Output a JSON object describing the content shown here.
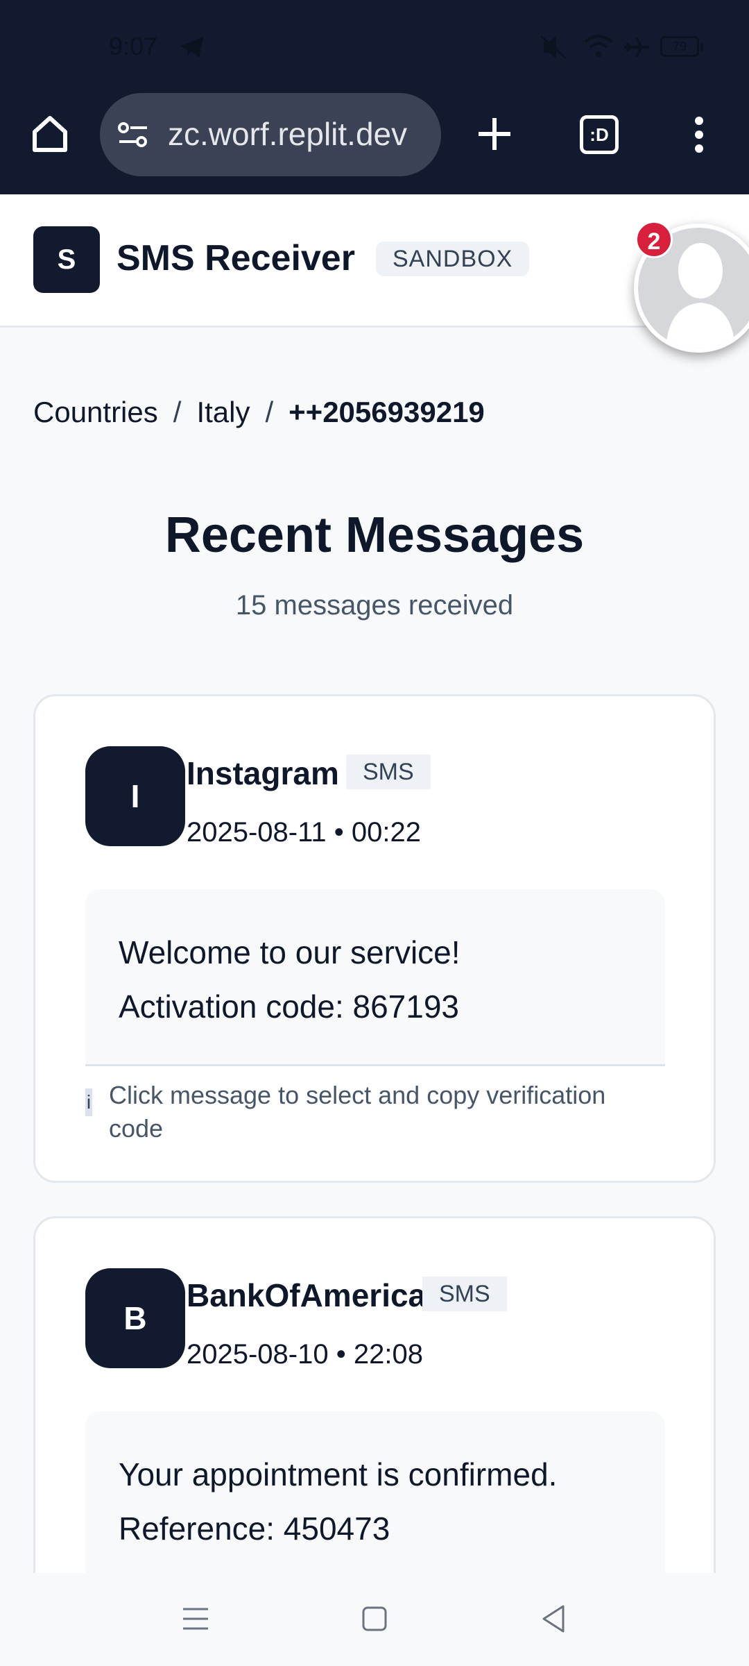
{
  "status_bar": {
    "time": "9:07",
    "battery": "79",
    "icons": [
      "telegram-icon",
      "mute-icon",
      "wifi-icon",
      "airplane-icon",
      "battery-icon"
    ]
  },
  "browser": {
    "url": "zc.worf.replit.dev",
    "tab_count": ":D",
    "icons": [
      "home-icon",
      "site-settings-icon",
      "new-tab-icon",
      "tab-switcher-icon",
      "more-menu-icon"
    ]
  },
  "header": {
    "logo_letter": "S",
    "title": "SMS Receiver",
    "badge": "SANDBOX",
    "notification_count": "2"
  },
  "breadcrumb": {
    "items": [
      "Countries",
      "Italy",
      "++2056939219"
    ],
    "separator": "/"
  },
  "main": {
    "title": "Recent Messages",
    "subtitle": "15 messages received"
  },
  "messages": [
    {
      "avatar_letter": "I",
      "sender": "Instagram",
      "type": "SMS",
      "timestamp": "2025-08-11 • 00:22",
      "body_lines": [
        "Welcome to our service!",
        "Activation code: 867193"
      ],
      "hint_icon": "i",
      "hint": "Click message to select and copy verification code"
    },
    {
      "avatar_letter": "B",
      "sender": "BankOfAmerica",
      "type": "SMS",
      "timestamp": "2025-08-10 • 22:08",
      "body_lines": [
        "Your appointment is confirmed.",
        "Reference: 450473"
      ]
    }
  ],
  "colors": {
    "chrome_bg": "#111a2e",
    "accent_dark": "#111a2e",
    "page_bg": "#f8f9fb",
    "notification_red": "#d81f3b"
  }
}
